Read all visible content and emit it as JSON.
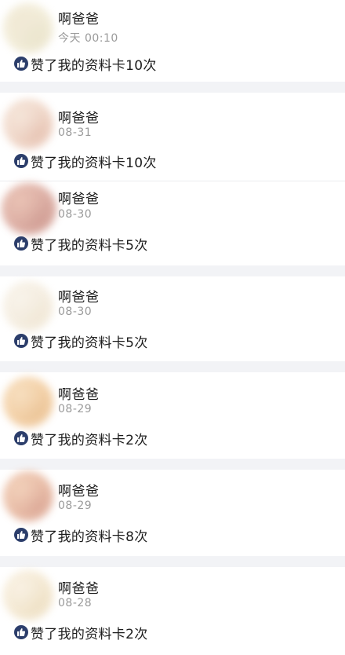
{
  "notifications": [
    {
      "name": "啊爸爸",
      "date": "今天 00:10",
      "action": "赞了我的资料卡10次",
      "avatar_colors": [
        "#f2ecd6",
        "#e7e0c4",
        "#efe6cf"
      ],
      "icon": "thumbs-up-icon"
    },
    {
      "name": "啊爸爸",
      "date": "08-31",
      "action": "赞了我的资料卡10次",
      "avatar_colors": [
        "#efd4c4",
        "#e3b9a6",
        "#f3e0d2"
      ],
      "icon": "thumbs-up-icon"
    },
    {
      "name": "啊爸爸",
      "date": "08-30",
      "action": "赞了我的资料卡5次",
      "avatar_colors": [
        "#d9a498",
        "#c98e83",
        "#e6b8a8"
      ],
      "icon": "thumbs-up-icon"
    },
    {
      "name": "啊爸爸",
      "date": "08-30",
      "action": "赞了我的资料卡5次",
      "avatar_colors": [
        "#f4ecde",
        "#efe4d0",
        "#f7f1e6"
      ],
      "icon": "thumbs-up-icon"
    },
    {
      "name": "啊爸爸",
      "date": "08-29",
      "action": "赞了我的资料卡2次",
      "avatar_colors": [
        "#f2ca9a",
        "#e9bb87",
        "#f6d9b4"
      ],
      "icon": "thumbs-up-icon"
    },
    {
      "name": "啊爸爸",
      "date": "08-29",
      "action": "赞了我的资料卡8次",
      "avatar_colors": [
        "#e7b59b",
        "#d69a86",
        "#f0c8ae"
      ],
      "icon": "thumbs-up-icon"
    },
    {
      "name": "啊爸爸",
      "date": "08-28",
      "action": "赞了我的资料卡2次",
      "avatar_colors": [
        "#f3e6cd",
        "#ecdcbc",
        "#f8efdf"
      ],
      "icon": "thumbs-up-icon"
    }
  ],
  "colors": {
    "background": "#ffffff",
    "separator": "#f2f3f6",
    "name_text": "#1c1c1c",
    "date_text": "#9a9a9a",
    "thumb_badge": "#2c3e6b"
  }
}
